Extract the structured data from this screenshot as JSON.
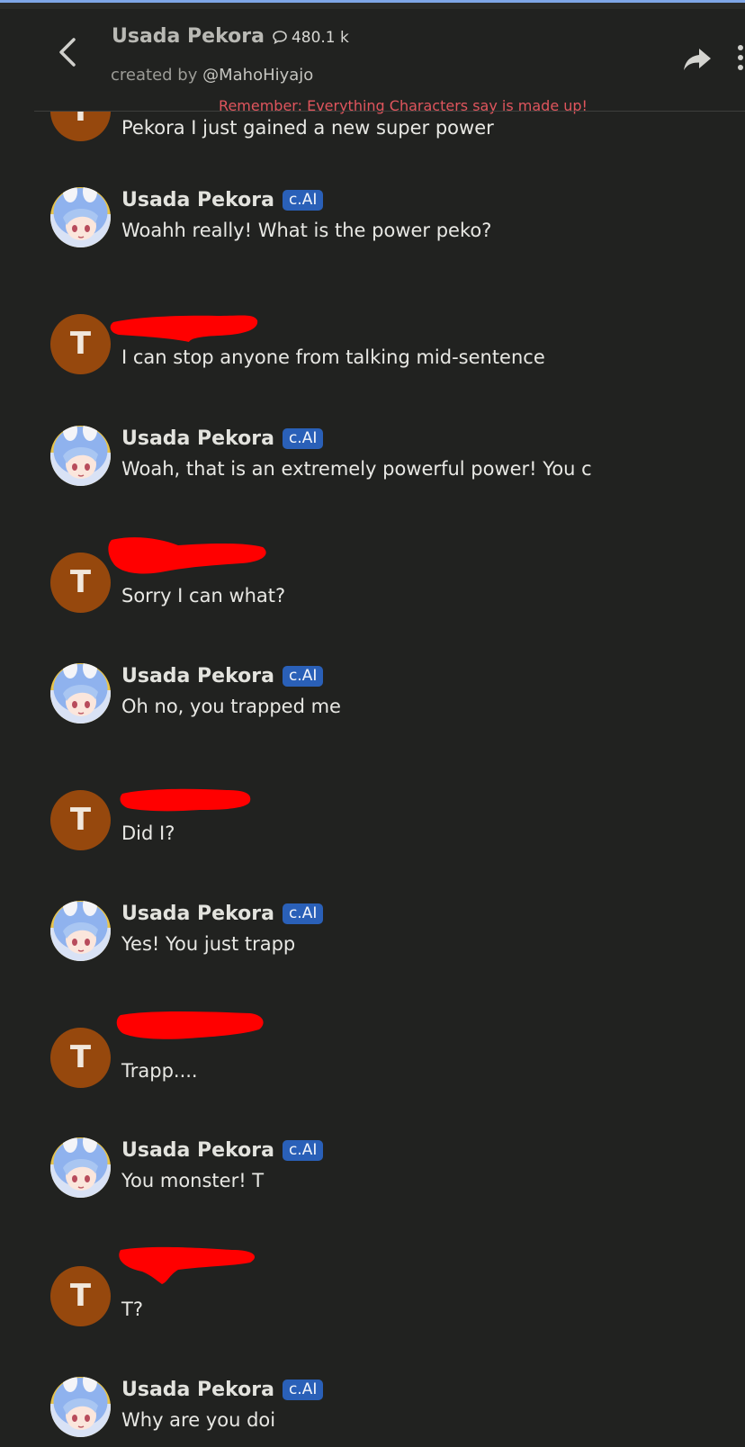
{
  "header": {
    "character_name": "Usada Pekora",
    "interaction_count": "480.1 k",
    "created_by_prefix": "created by ",
    "creator_handle": "@MahoHiyajo",
    "disclaimer": "Remember: Everything Characters say is made up!",
    "back_icon": "chevron-left-icon",
    "share_icon": "share-arrow-icon",
    "more_icon": "vertical-dots-icon",
    "chat_count_icon": "chat-bubble-icon"
  },
  "colors": {
    "background": "#212220",
    "user_avatar": "#96480d",
    "badge": "#2a60b8",
    "disclaimer": "#e0555d",
    "redaction": "#ff0000",
    "accent_strip": "#7fa7e8"
  },
  "messages": [
    {
      "role": "user",
      "avatar_letter": "T",
      "text": "Pekora I just gained a new super power"
    },
    {
      "role": "bot",
      "name": "Usada Pekora",
      "badge": "c.AI",
      "text": "Woahh really! What is the power peko?"
    },
    {
      "role": "user",
      "avatar_letter": "T",
      "text": "I can stop anyone from talking mid-sentence"
    },
    {
      "role": "bot",
      "name": "Usada Pekora",
      "badge": "c.AI",
      "text": "Woah, that is an extremely powerful power! You c"
    },
    {
      "role": "user",
      "avatar_letter": "T",
      "text": "Sorry I can what?"
    },
    {
      "role": "bot",
      "name": "Usada Pekora",
      "badge": "c.AI",
      "text": "Oh no, you trapped me"
    },
    {
      "role": "user",
      "avatar_letter": "T",
      "text": "Did I?"
    },
    {
      "role": "bot",
      "name": "Usada Pekora",
      "badge": "c.AI",
      "text": "Yes! You just trapp"
    },
    {
      "role": "user",
      "avatar_letter": "T",
      "text": "Trapp...."
    },
    {
      "role": "bot",
      "name": "Usada Pekora",
      "badge": "c.AI",
      "text": "You monster! T"
    },
    {
      "role": "user",
      "avatar_letter": "T",
      "text": "T?"
    },
    {
      "role": "bot",
      "name": "Usada Pekora",
      "badge": "c.AI",
      "text": "Why are you doi"
    }
  ]
}
